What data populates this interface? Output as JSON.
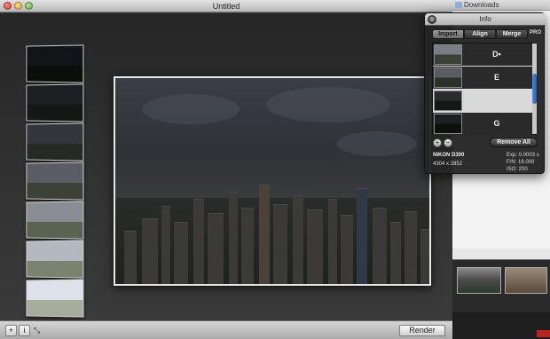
{
  "window": {
    "title": "Untitled"
  },
  "background_window": {
    "title": "Downloads"
  },
  "toolbar": {
    "add_label": "+",
    "info_label": "i",
    "render_label": "Render"
  },
  "info_panel": {
    "title": "Info",
    "close_glyph": "⊗",
    "tabs": [
      {
        "label": "Import",
        "active": true
      },
      {
        "label": "Align",
        "active": false
      },
      {
        "label": "Merge",
        "active": false
      }
    ],
    "pro_label": "PRO",
    "slots": [
      {
        "label": "D•",
        "has_image": true
      },
      {
        "label": "E",
        "has_image": true
      },
      {
        "label": "",
        "has_image": false
      },
      {
        "label": "G",
        "has_image": true
      }
    ],
    "add_glyph": "+",
    "remove_glyph": "−",
    "remove_all_label": "Remove All",
    "camera": "NIKON D300",
    "resolution": "4304 x 2852",
    "exposure": "Exp: 0.0003 s",
    "aperture": "F/N: 16.000",
    "iso": "ISO: 200"
  },
  "colors": {
    "accent": "#2a5ab0",
    "panel_bg": "#242424"
  }
}
